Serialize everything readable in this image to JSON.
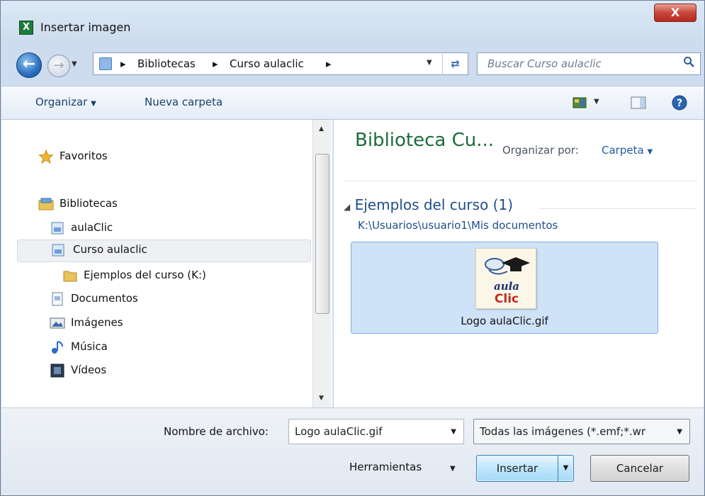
{
  "window": {
    "title": "Insertar imagen",
    "close_label": "X",
    "app_icon_label": "X"
  },
  "address": {
    "segments": [
      "Bibliotecas",
      "Curso aulaclic"
    ],
    "search_placeholder": "Buscar Curso aulaclic"
  },
  "toolbar": {
    "organize_label": "Organizar",
    "new_folder_label": "Nueva carpeta"
  },
  "nav": {
    "favorites_label": "Favoritos",
    "libraries_label": "Bibliotecas",
    "items": [
      {
        "label": "aulaClic",
        "icon": "library-icon"
      },
      {
        "label": "Curso aulaclic",
        "icon": "library-icon",
        "selected": true
      },
      {
        "label": "Ejemplos del curso (K:)",
        "icon": "folder-icon"
      },
      {
        "label": "Documentos",
        "icon": "documents-icon"
      },
      {
        "label": "Imágenes",
        "icon": "pictures-icon"
      },
      {
        "label": "Música",
        "icon": "music-icon"
      },
      {
        "label": "Vídeos",
        "icon": "videos-icon"
      }
    ]
  },
  "content": {
    "library_title": "Biblioteca Cu...",
    "arrange_label": "Organizar por:",
    "arrange_value": "Carpeta",
    "group_header": "Ejemplos del curso (1)",
    "group_path": "K:\\Usuarios\\usuario1\\Mis documentos",
    "file": {
      "name": "Logo aulaClic.gif",
      "thumb_text_top": "aula",
      "thumb_text_bottom": "Clic"
    }
  },
  "bottom": {
    "filename_label": "Nombre de archivo:",
    "filename_value": "Logo aulaClic.gif",
    "filetype_value": "Todas las imágenes (*.emf;*.wr",
    "tools_label": "Herramientas",
    "insert_label": "Insertar",
    "cancel_label": "Cancelar"
  },
  "colors": {
    "accent": "#1e6b3a",
    "link": "#1e4e8c",
    "selection": "#cfe3f8"
  }
}
